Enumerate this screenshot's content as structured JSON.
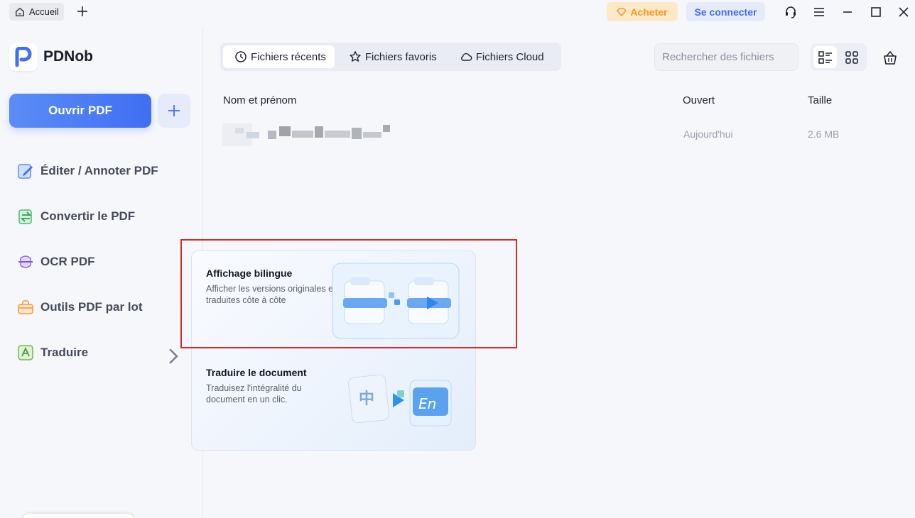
{
  "titlebar": {
    "home_tab": "Accueil",
    "buy_label": "Acheter",
    "login_label": "Se connecter",
    "colors": {
      "buy_bg": "#fde9c8",
      "buy_text": "#f29a1f",
      "login_bg": "#e6ebfa",
      "login_text": "#3f6fe6"
    }
  },
  "sidebar": {
    "app_name": "PDNob",
    "open_pdf": "Ouvrir PDF",
    "items": [
      {
        "label": "Éditer / Annoter PDF",
        "icon": "edit-annotate-icon"
      },
      {
        "label": "Convertir le PDF",
        "icon": "convert-icon"
      },
      {
        "label": "OCR PDF",
        "icon": "ocr-icon"
      },
      {
        "label": "Outils PDF par lot",
        "icon": "batch-tools-icon"
      },
      {
        "label": "Traduire",
        "icon": "translate-icon"
      }
    ],
    "accent": "#3f6ff2"
  },
  "main": {
    "tabs": [
      {
        "label": "Fichiers récents",
        "icon": "clock-icon",
        "active": true
      },
      {
        "label": "Fichiers favoris",
        "icon": "star-icon",
        "active": false
      },
      {
        "label": "Fichiers Cloud",
        "icon": "cloud-icon",
        "active": false
      }
    ],
    "search_placeholder": "Rechercher des fichiers",
    "columns": {
      "name": "Nom et prénom",
      "opened": "Ouvert",
      "size": "Taille"
    },
    "rows": [
      {
        "name": "",
        "opened": "Aujourd'hui",
        "size": "2.6 MB"
      }
    ]
  },
  "translate_menu": {
    "cards": [
      {
        "title": "Affichage bilingue",
        "desc": "Afficher les versions originales et traduites côte à côte"
      },
      {
        "title": "Traduire le document",
        "desc": "Traduisez l'intégralité du document en un clic."
      }
    ],
    "glyph_source": "中",
    "glyph_target": "En",
    "highlight_color": "#d62a2a"
  }
}
